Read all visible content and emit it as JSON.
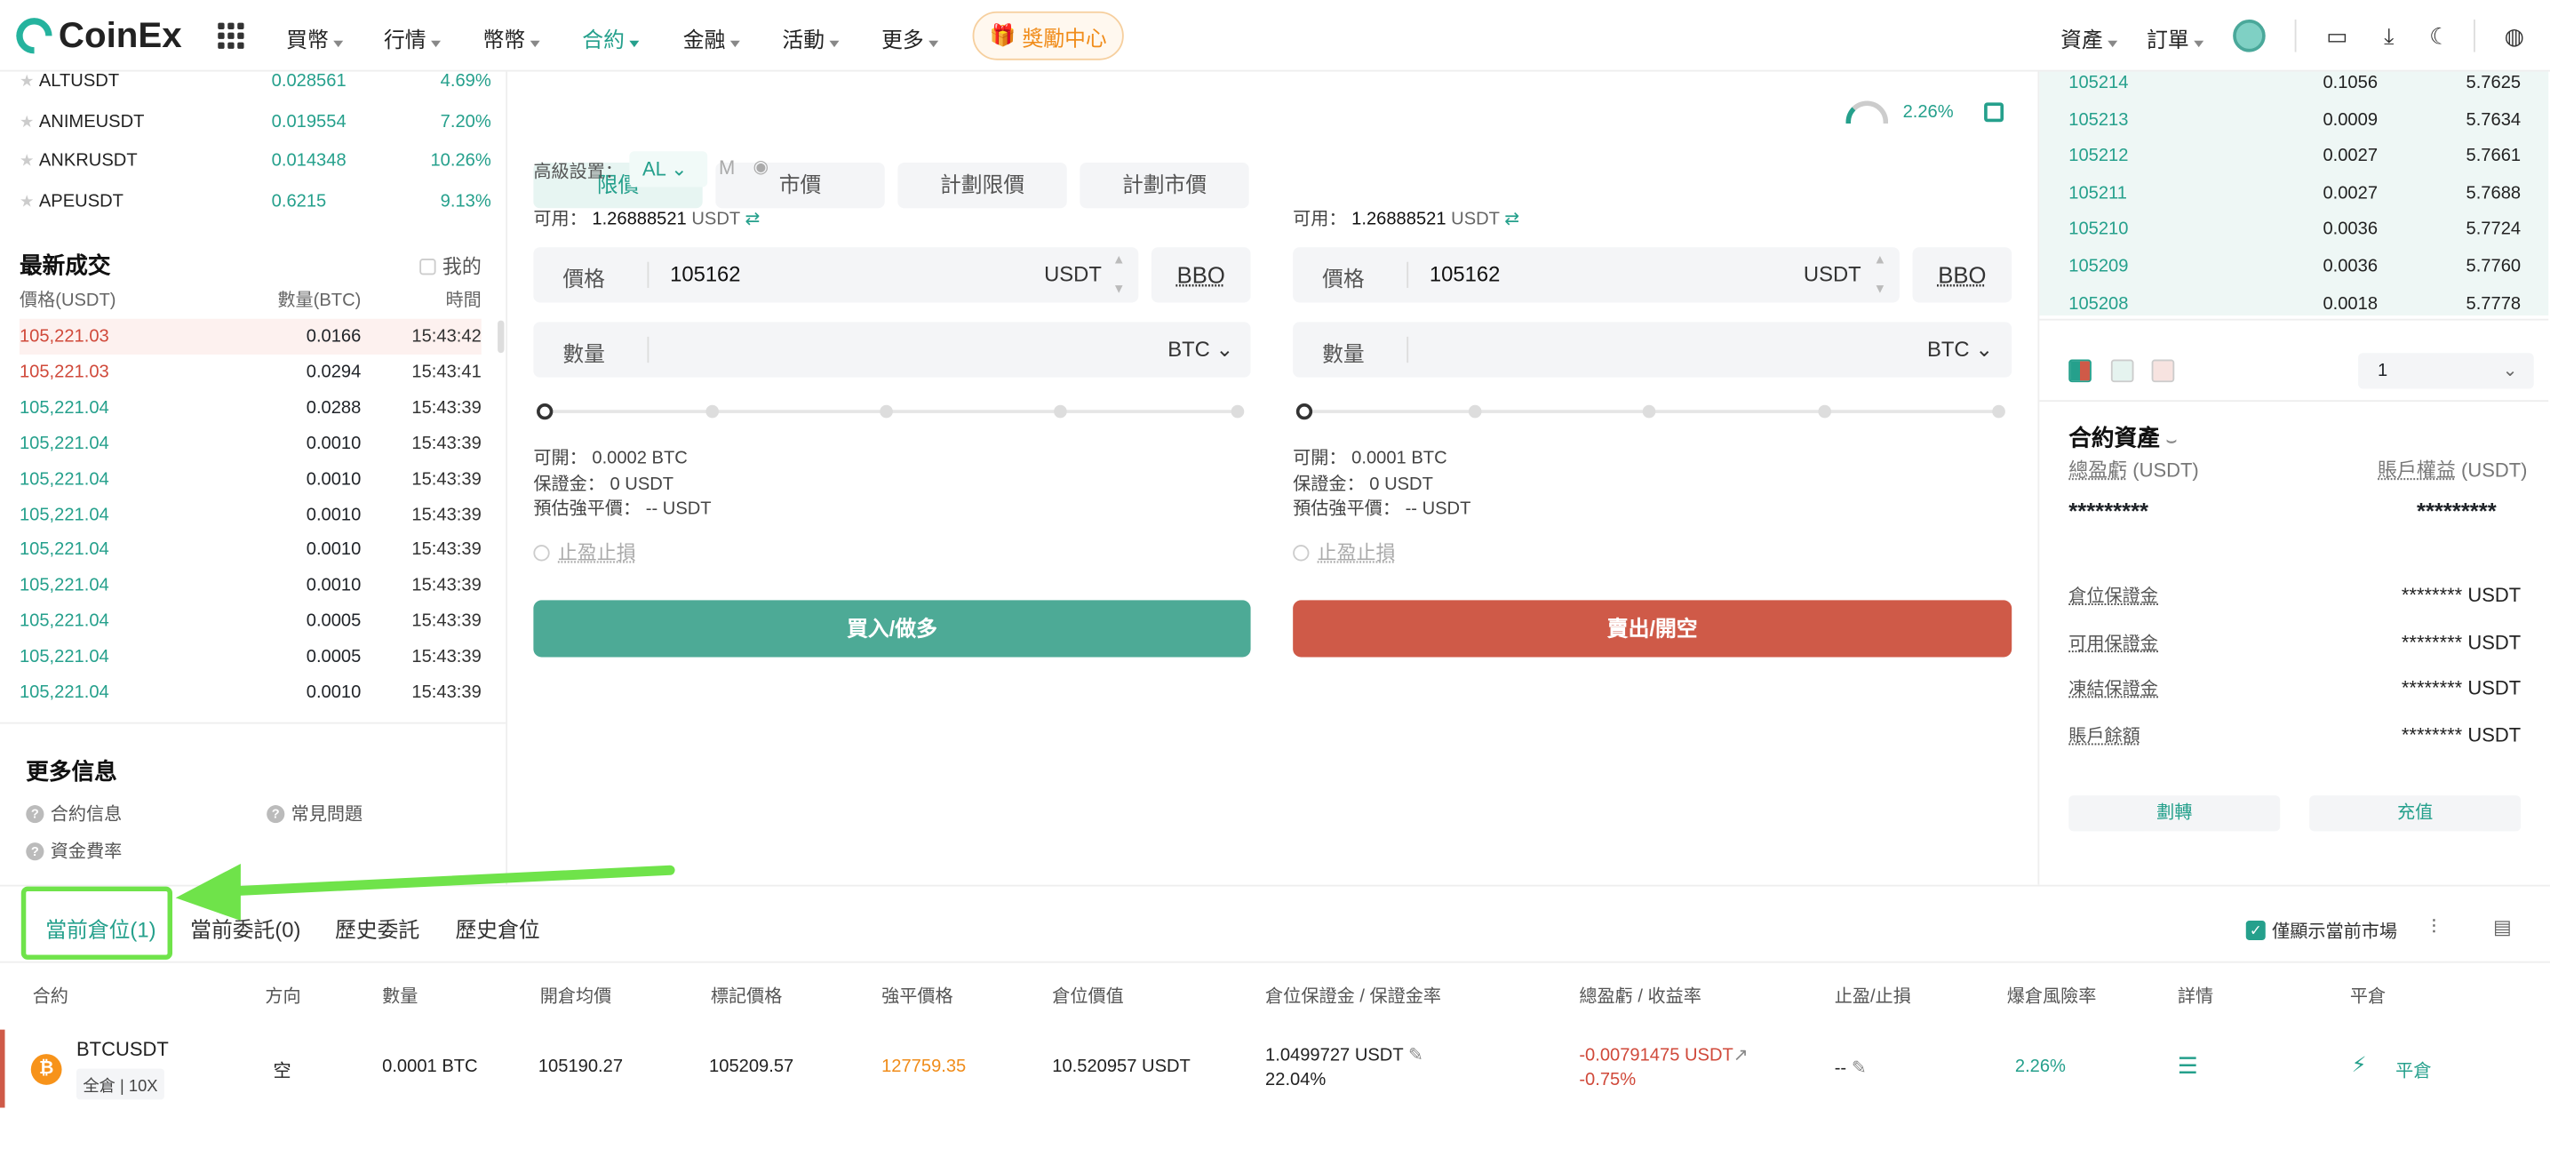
{
  "nav": {
    "logo": "CoinEx",
    "menu": [
      "買幣",
      "行情",
      "幣幣",
      "合約",
      "金融",
      "活動",
      "更多"
    ],
    "promo": "獎勵中心",
    "right": [
      "資產",
      "訂單"
    ]
  },
  "markets": [
    {
      "sym": "ALTUSDT",
      "price": "0.028561",
      "chg": "4.69%"
    },
    {
      "sym": "ANIMEUSDT",
      "price": "0.019554",
      "chg": "7.20%"
    },
    {
      "sym": "ANKRUSDT",
      "price": "0.014348",
      "chg": "10.26%"
    },
    {
      "sym": "APEUSDT",
      "price": "0.6215",
      "chg": "9.13%"
    }
  ],
  "trades": {
    "title": "最新成交",
    "mine": "我的",
    "headers": [
      "價格(USDT)",
      "數量(BTC)",
      "時間"
    ],
    "rows": [
      {
        "p": "105,221.03",
        "q": "0.0166",
        "t": "15:43:42",
        "side": "red"
      },
      {
        "p": "105,221.03",
        "q": "0.0294",
        "t": "15:43:41",
        "side": "red"
      },
      {
        "p": "105,221.04",
        "q": "0.0288",
        "t": "15:43:39",
        "side": "green"
      },
      {
        "p": "105,221.04",
        "q": "0.0010",
        "t": "15:43:39",
        "side": "green"
      },
      {
        "p": "105,221.04",
        "q": "0.0010",
        "t": "15:43:39",
        "side": "green"
      },
      {
        "p": "105,221.04",
        "q": "0.0010",
        "t": "15:43:39",
        "side": "green"
      },
      {
        "p": "105,221.04",
        "q": "0.0010",
        "t": "15:43:39",
        "side": "green"
      },
      {
        "p": "105,221.04",
        "q": "0.0010",
        "t": "15:43:39",
        "side": "green"
      },
      {
        "p": "105,221.04",
        "q": "0.0005",
        "t": "15:43:39",
        "side": "green"
      },
      {
        "p": "105,221.04",
        "q": "0.0005",
        "t": "15:43:39",
        "side": "green"
      },
      {
        "p": "105,221.04",
        "q": "0.0010",
        "t": "15:43:39",
        "side": "green"
      }
    ]
  },
  "more": {
    "title": "更多信息",
    "items": [
      "合約信息",
      "常見問題",
      "資金費率"
    ]
  },
  "order": {
    "tabs": [
      "限價",
      "市價",
      "計劃限價",
      "計劃市價"
    ],
    "ratio": "2.26%",
    "adv_label": "高級設置：",
    "adv_mode": "AL",
    "adv_m": "M",
    "buy": {
      "avail_label": "可用：",
      "avail": "1.26888521",
      "avail_unit": "USDT",
      "price_label": "價格",
      "price": "105162",
      "price_unit": "USDT",
      "bbo": "BBO",
      "qty_label": "數量",
      "qty_unit": "BTC",
      "open": "可開： 0.0002 BTC",
      "margin": "保證金： 0 USDT",
      "liq": "預估強平價： -- USDT",
      "sltp": "止盈止損",
      "btn": "買入/做多"
    },
    "sell": {
      "avail_label": "可用：",
      "avail": "1.26888521",
      "avail_unit": "USDT",
      "price_label": "價格",
      "price": "105162",
      "price_unit": "USDT",
      "bbo": "BBO",
      "qty_label": "數量",
      "qty_unit": "BTC",
      "open": "可開： 0.0001 BTC",
      "margin": "保證金： 0 USDT",
      "liq": "預估強平價： -- USDT",
      "sltp": "止盈止損",
      "btn": "賣出/開空"
    }
  },
  "orderbook": [
    {
      "p": "105214",
      "q": "0.1056",
      "t": "5.7625"
    },
    {
      "p": "105213",
      "q": "0.0009",
      "t": "5.7634"
    },
    {
      "p": "105212",
      "q": "0.0027",
      "t": "5.7661"
    },
    {
      "p": "105211",
      "q": "0.0027",
      "t": "5.7688"
    },
    {
      "p": "105210",
      "q": "0.0036",
      "t": "5.7724"
    },
    {
      "p": "105209",
      "q": "0.0036",
      "t": "5.7760"
    },
    {
      "p": "105208",
      "q": "0.0018",
      "t": "5.7778"
    }
  ],
  "depth_select": "1",
  "assets": {
    "title": "合約資產",
    "pnl_label": "總盈虧",
    "pnl_unit": "(USDT)",
    "equity_label": "賬戶權益",
    "equity_unit": "(USDT)",
    "hidden": "*********",
    "rows": [
      {
        "k": "倉位保證金",
        "v": "******** USDT"
      },
      {
        "k": "可用保證金",
        "v": "******** USDT"
      },
      {
        "k": "凍結保證金",
        "v": "******** USDT"
      },
      {
        "k": "賬戶餘額",
        "v": "******** USDT"
      }
    ],
    "transfer": "劃轉",
    "deposit": "充值"
  },
  "positions": {
    "tabs": [
      "當前倉位(1)",
      "當前委託(0)",
      "歷史委託",
      "歷史倉位"
    ],
    "only_current": "僅顯示當前市場",
    "headers": [
      "合約",
      "方向",
      "數量",
      "開倉均價",
      "標記價格",
      "強平價格",
      "倉位價值",
      "倉位保證金 / 保證金率",
      "總盈虧 / 收益率",
      "止盈/止損",
      "爆倉風險率",
      "詳情",
      "平倉"
    ],
    "row": {
      "symbol": "BTCUSDT",
      "mode": "全倉 | 10X",
      "dir": "空",
      "qty": "0.0001 BTC",
      "entry": "105190.27",
      "mark": "105209.57",
      "liq": "127759.35",
      "value": "10.520957 USDT",
      "margin": "1.0499727 USDT",
      "margin_rate": "22.04%",
      "pnl": "-0.00791475 USDT",
      "roe": "-0.75%",
      "sltp": "--",
      "risk": "2.26%",
      "close": "平倉"
    }
  }
}
